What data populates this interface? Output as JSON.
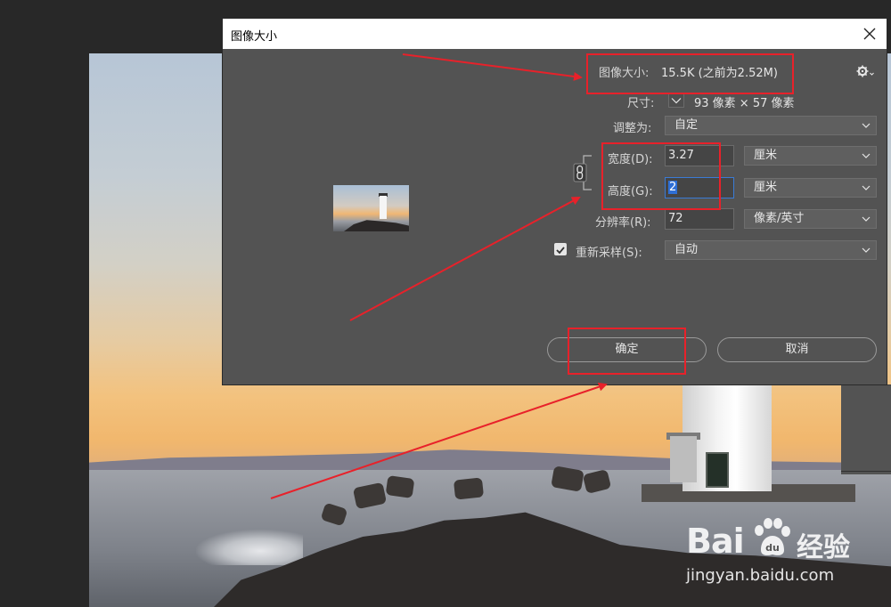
{
  "dialog": {
    "title": "图像大小",
    "image_size_label": "图像大小:",
    "image_size_value": "15.5K (之前为2.52M)",
    "dimensions_label": "尺寸:",
    "dimensions_value": "93 像素  ×  57 像素",
    "fit_to_label": "调整为:",
    "fit_to_value": "自定",
    "width_label": "宽度(D):",
    "width_value": "3.27",
    "width_unit": "厘米",
    "height_label": "高度(G):",
    "height_value": "2",
    "height_unit": "厘米",
    "resolution_label": "分辨率(R):",
    "resolution_value": "72",
    "resolution_unit": "像素/英寸",
    "resample_label": "重新采样(S):",
    "resample_checked": true,
    "resample_value": "自动",
    "ok_label": "确定",
    "cancel_label": "取消"
  },
  "watermark": {
    "brand_bai": "Bai",
    "brand_du": "经验",
    "url": "jingyan.baidu.com"
  },
  "colors": {
    "annotation": "#e8212a",
    "dialog_bg": "#535353",
    "focus": "#2f6fd6"
  }
}
